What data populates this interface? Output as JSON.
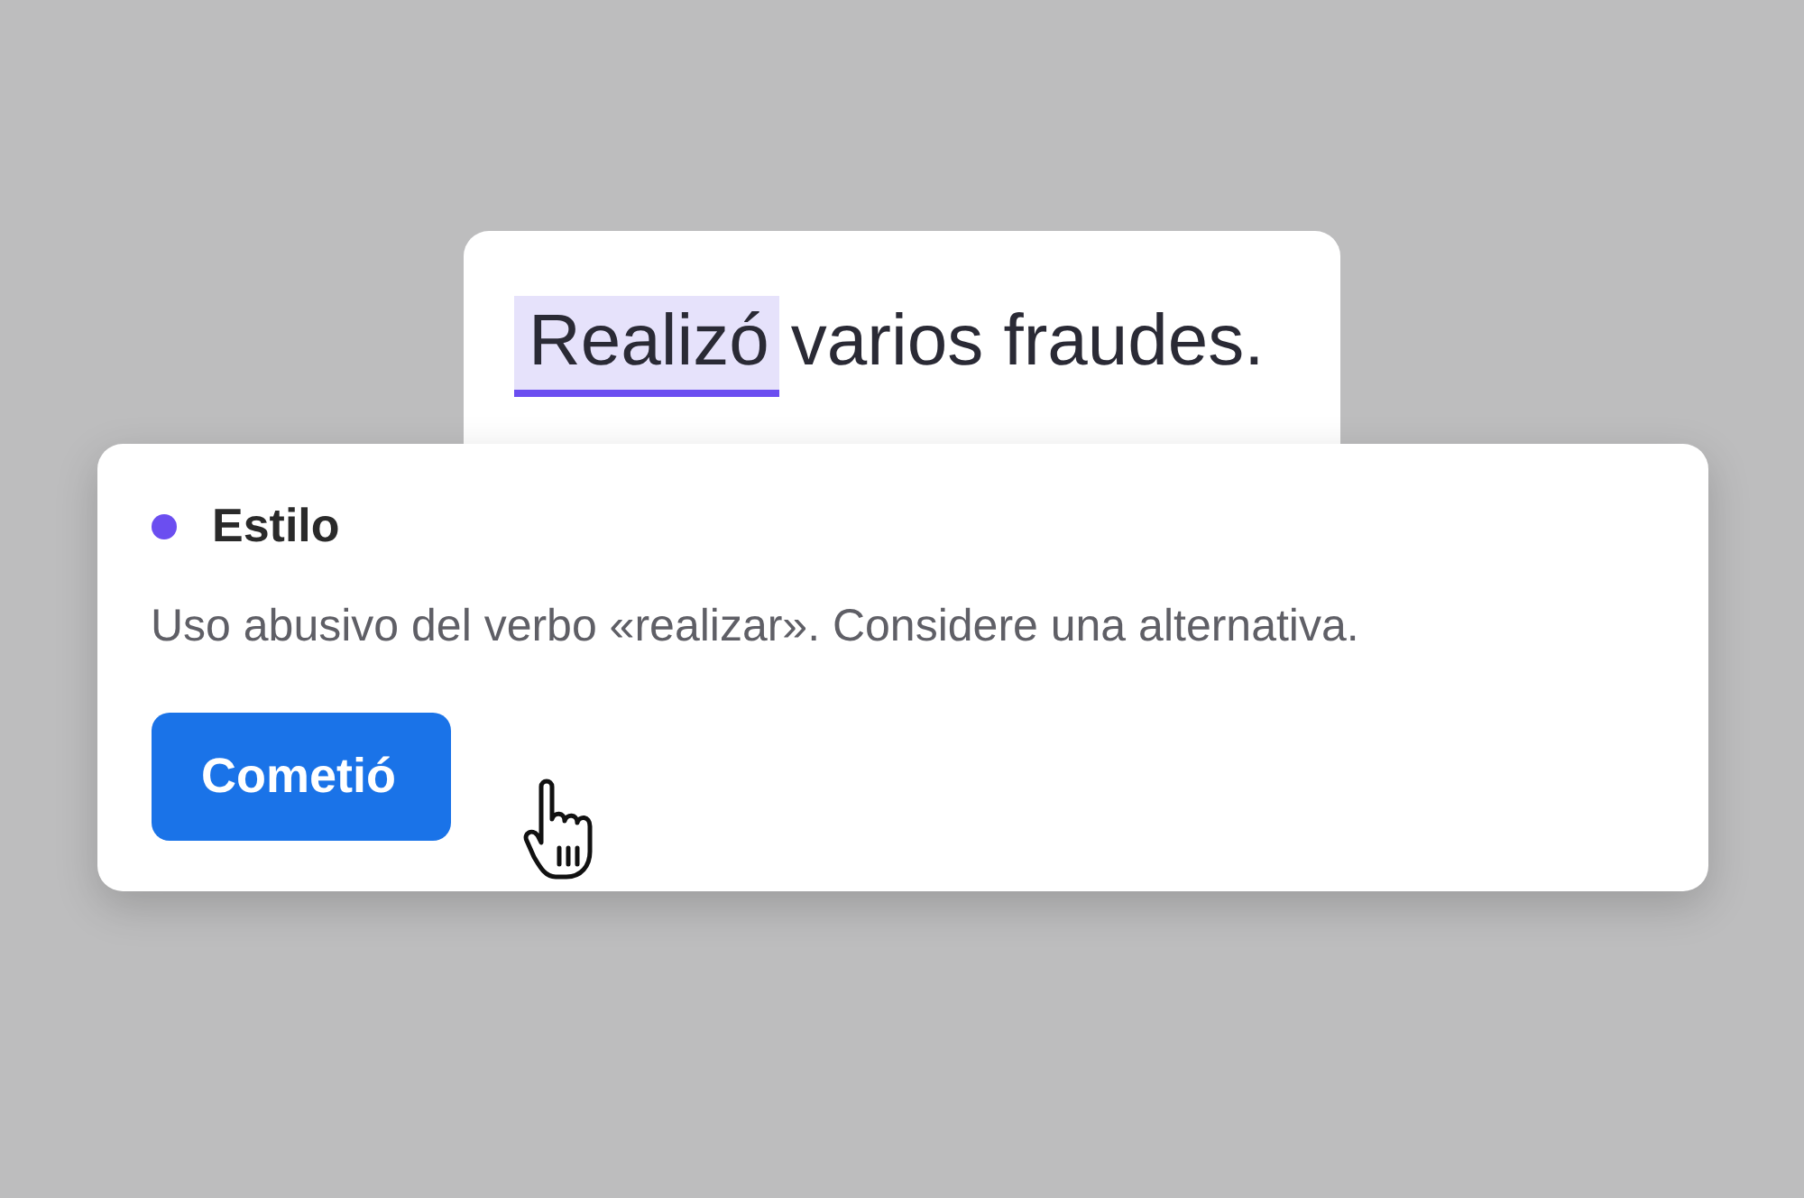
{
  "sentence": {
    "flagged_word": "Realizó",
    "rest": "varios fraudes."
  },
  "suggestion": {
    "category": "Estilo",
    "color": "#6b4ef0",
    "message": "Uso abusivo del verbo «realizar». Considere una alternativa.",
    "replacement": "Cometió"
  }
}
